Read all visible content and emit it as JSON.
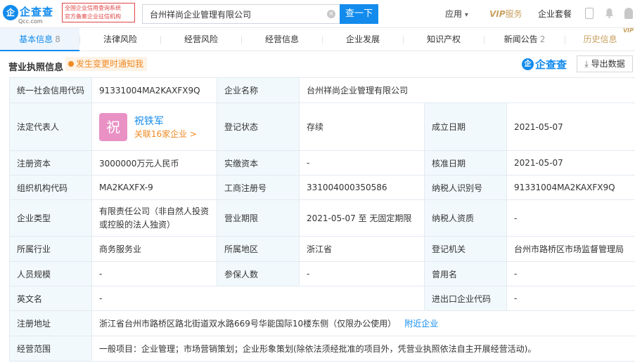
{
  "brand": {
    "logo_char": "企",
    "logo_text": "企查查",
    "logo_sub": "Qcc.com",
    "badge_line1": "全国企业信用查询系统",
    "badge_line2": "官方备案企业征信机构"
  },
  "search": {
    "value": "台州祥尚企业管理有限公司",
    "button": "查一下",
    "clear_icon": "×"
  },
  "nav": {
    "apps": "应用",
    "apps_caret": "▾",
    "vip": "VIP",
    "vip_service": "服务",
    "package": "企业套餐"
  },
  "tabs": [
    {
      "label": "基本信息",
      "count": "8"
    },
    {
      "label": "法律风险",
      "count": ""
    },
    {
      "label": "经营风险",
      "count": ""
    },
    {
      "label": "经营信息",
      "count": ""
    },
    {
      "label": "企业发展",
      "count": ""
    },
    {
      "label": "知识产权",
      "count": ""
    },
    {
      "label": "新闻公告",
      "count": "2"
    },
    {
      "label": "历史信息",
      "count": "",
      "badge": "VIP"
    }
  ],
  "section": {
    "title": "营业执照信息",
    "notify": "发生变更时通知我",
    "watermark_char": "企",
    "watermark_text": "企查查",
    "export_icon": "⤓",
    "export": "导出数据"
  },
  "info": {
    "credit_code_label": "统一社会信用代码",
    "credit_code": "91331004MA2KAXFX9Q",
    "company_name_label": "企业名称",
    "company_name": "台州祥尚企业管理有限公司",
    "legal_rep_label": "法定代表人",
    "legal_rep_avatar": "祝",
    "legal_rep_name": "祝铁军",
    "legal_rep_related": "关联16家企业 >",
    "reg_status_label": "登记状态",
    "reg_status": "存续",
    "est_date_label": "成立日期",
    "est_date": "2021-05-07",
    "reg_capital_label": "注册资本",
    "reg_capital": "3000000万元人民币",
    "paid_capital_label": "实缴资本",
    "paid_capital": "-",
    "approval_date_label": "核准日期",
    "approval_date": "2021-05-07",
    "org_code_label": "组织机构代码",
    "org_code": "MA2KAXFX-9",
    "biz_reg_no_label": "工商注册号",
    "biz_reg_no": "331004000350586",
    "taxpayer_id_label": "纳税人识别号",
    "taxpayer_id": "91331004MA2KAXFX9Q",
    "company_type_label": "企业类型",
    "company_type": "有限责任公司（非自然人投资或控股的法人独资）",
    "biz_term_label": "营业期限",
    "biz_term": "2021-05-07 至 无固定期限",
    "taxpayer_qual_label": "纳税人资质",
    "taxpayer_qual": "-",
    "industry_label": "所属行业",
    "industry": "商务服务业",
    "region_label": "所属地区",
    "region": "浙江省",
    "reg_authority_label": "登记机关",
    "reg_authority": "台州市路桥区市场监督管理局",
    "staff_size_label": "人员规模",
    "staff_size": "-",
    "insured_label": "参保人数",
    "insured": "-",
    "former_name_label": "曾用名",
    "former_name": "-",
    "english_name_label": "英文名",
    "english_name": "-",
    "import_export_label": "进出口企业代码",
    "import_export": "-",
    "address_label": "注册地址",
    "address": "浙江省台州市路桥区路北街道双水路669号华能国际10楼东侧（仅限办公使用）",
    "nearby": "附近企业",
    "scope_label": "经营范围",
    "scope": "一般项目：企业管理；市场营销策划；企业形象策划(除依法须经批准的项目外，凭营业执照依法自主开展经营活动)。"
  }
}
